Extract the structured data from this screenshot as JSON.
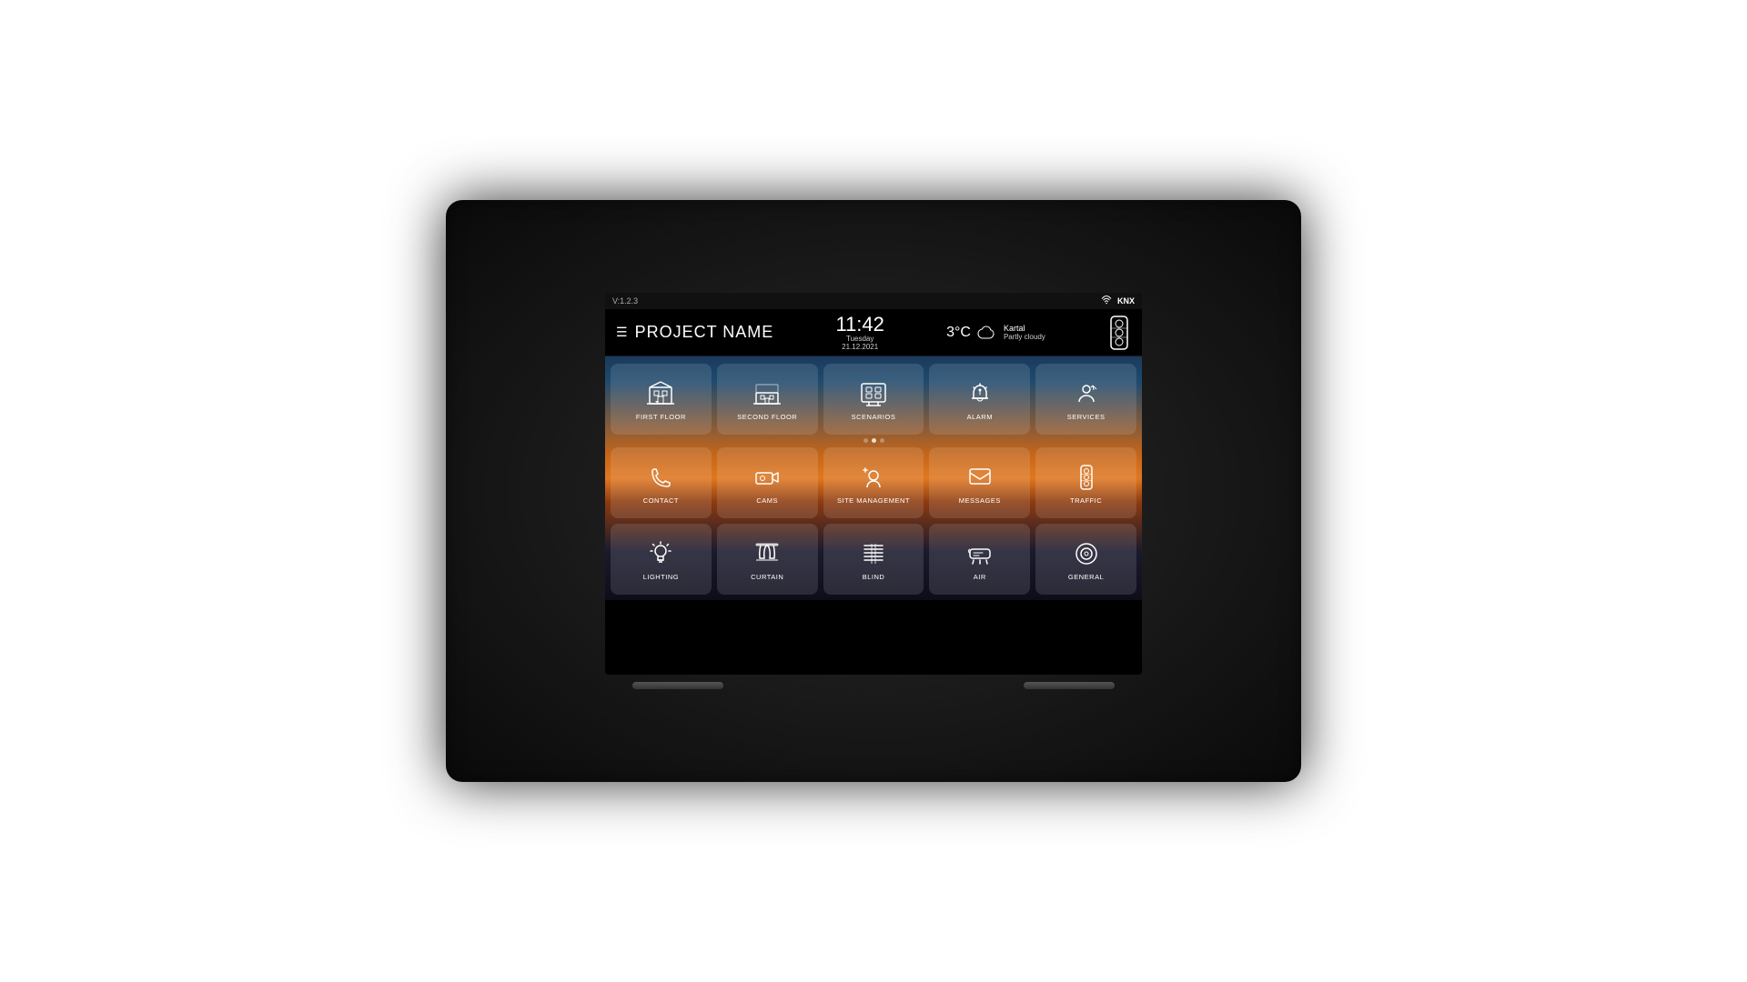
{
  "app": {
    "version": "V:1.2.3",
    "project_name": "PROJECT NAME",
    "time": "11:42",
    "day": "Tuesday",
    "date": "21.12.2021",
    "temperature": "3°C",
    "weather_icon": "☁",
    "weather_location": "Kartal",
    "weather_desc": "Partly cloudy",
    "wifi_label": "WiFi",
    "knx_label": "KNX"
  },
  "nav": {
    "hamburger_label": "☰"
  },
  "rows": [
    {
      "id": "row1",
      "items": [
        {
          "id": "first-floor",
          "label": "FIRST FLOOR",
          "icon": "floor1"
        },
        {
          "id": "second-floor",
          "label": "SECOND FLOOR",
          "icon": "floor2"
        },
        {
          "id": "scenarios",
          "label": "SCENARIOS",
          "icon": "scenarios"
        },
        {
          "id": "alarm",
          "label": "ALARM",
          "icon": "alarm"
        },
        {
          "id": "services",
          "label": "SERVICES",
          "icon": "services"
        }
      ]
    },
    {
      "id": "row2",
      "items": [
        {
          "id": "contact",
          "label": "CONTACT",
          "icon": "contact"
        },
        {
          "id": "cams",
          "label": "CAMS",
          "icon": "cams"
        },
        {
          "id": "site-management",
          "label": "SITE MANAGEMENT",
          "icon": "site"
        },
        {
          "id": "messages",
          "label": "MESSAGES",
          "icon": "messages"
        },
        {
          "id": "traffic",
          "label": "TRAFFIC",
          "icon": "traffic"
        }
      ]
    },
    {
      "id": "row3",
      "items": [
        {
          "id": "lighting",
          "label": "LIGHTING",
          "icon": "lighting"
        },
        {
          "id": "curtain",
          "label": "CURTAIN",
          "icon": "curtain"
        },
        {
          "id": "blind",
          "label": "BLIND",
          "icon": "blind"
        },
        {
          "id": "air",
          "label": "AIR",
          "icon": "air"
        },
        {
          "id": "general",
          "label": "GENERAL",
          "icon": "general"
        }
      ]
    }
  ],
  "dots": [
    false,
    true,
    false
  ]
}
